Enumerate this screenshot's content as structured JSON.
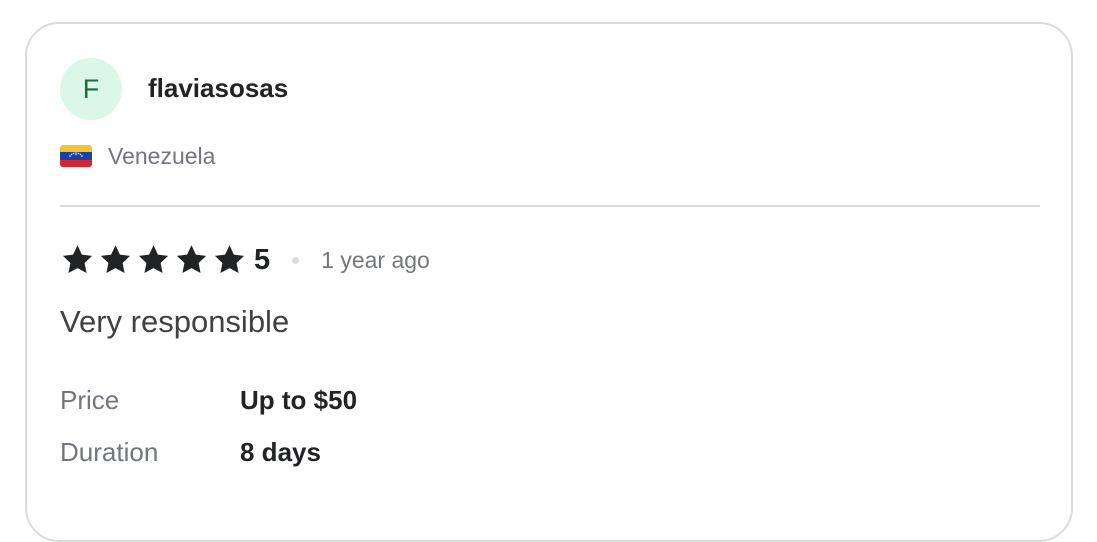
{
  "review": {
    "avatar_initial": "F",
    "username": "flaviasosas",
    "country": "Venezuela",
    "flag_icon": "venezuela-flag-icon",
    "rating_stars": 5,
    "rating_value": "5",
    "time_ago": "1 year ago",
    "text": "Very responsible",
    "meta": {
      "price_label": "Price",
      "price_value": "Up to $50",
      "duration_label": "Duration",
      "duration_value": "8 days"
    }
  },
  "colors": {
    "avatar_bg": "#daf7e8",
    "avatar_text": "#1d6b41",
    "star": "#222325",
    "border": "#dadbdd"
  }
}
